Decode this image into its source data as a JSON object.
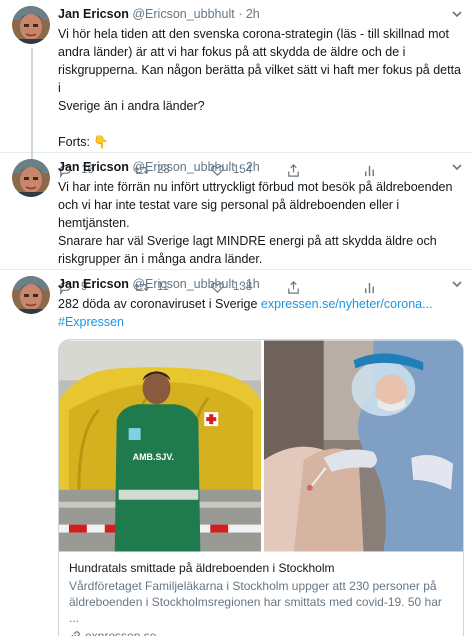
{
  "tweets": [
    {
      "name": "Jan Ericson",
      "handle": "@Ericson_ubbhult",
      "dot": "·",
      "time": "2h",
      "lines": [
        "Vi hör hela tiden att den svenska corona-strategin (läs - till skillnad mot",
        "andra länder) är att vi har fokus på att skydda de äldre och de i",
        "riskgrupperna. Kan någon berätta på vilket sätt vi haft mer fokus på detta i",
        "Sverige än i andra länder?"
      ],
      "extra": "Forts: 👇",
      "replies": "16",
      "retweets": "28",
      "likes": "154"
    },
    {
      "name": "Jan Ericson",
      "handle": "@Ericson_ubbhult",
      "dot": "·",
      "time": "2h",
      "lines": [
        "Vi har inte förrän nu infört uttryckligt förbud mot besök på äldreboenden",
        "och vi har inte testat vare sig personal på äldreboenden eller i hemtjänsten.",
        "Snarare har väl Sverige lagt MINDRE energi på att skydda äldre och",
        "riskgrupper än i många andra länder."
      ],
      "replies": "9",
      "retweets": "11",
      "likes": "138"
    },
    {
      "name": "Jan Ericson",
      "handle": "@Ericson_ubbhult",
      "dot": "·",
      "time": "1h",
      "text": "282 döda av coronaviruset i Sverige",
      "url": "expressen.se/nyheter/corona...",
      "hashtag": "#Expressen",
      "card": {
        "title": "Hundratals smittade på äldreboenden i Stockholm",
        "desc1": "Vårdföretaget Familjeläkarna i Stockholm uppger att 230 personer på",
        "desc2": "äldreboenden i Stockholmsregionen har smittats med covid-19. 50 har ...",
        "domain": "expressen.se",
        "vest_text": "AMB.SJV."
      }
    }
  ],
  "icons": {
    "reply": "reply-icon",
    "retweet": "retweet-icon",
    "like": "heart-icon",
    "share": "share-icon",
    "analytics": "analytics-icon",
    "caret": "chevron-down-icon",
    "link": "link-icon"
  },
  "colors": {
    "text": "#14171a",
    "muted": "#657786",
    "link": "#1b95e0",
    "border": "#e6ecf0",
    "thread": "#ccd6dd"
  }
}
